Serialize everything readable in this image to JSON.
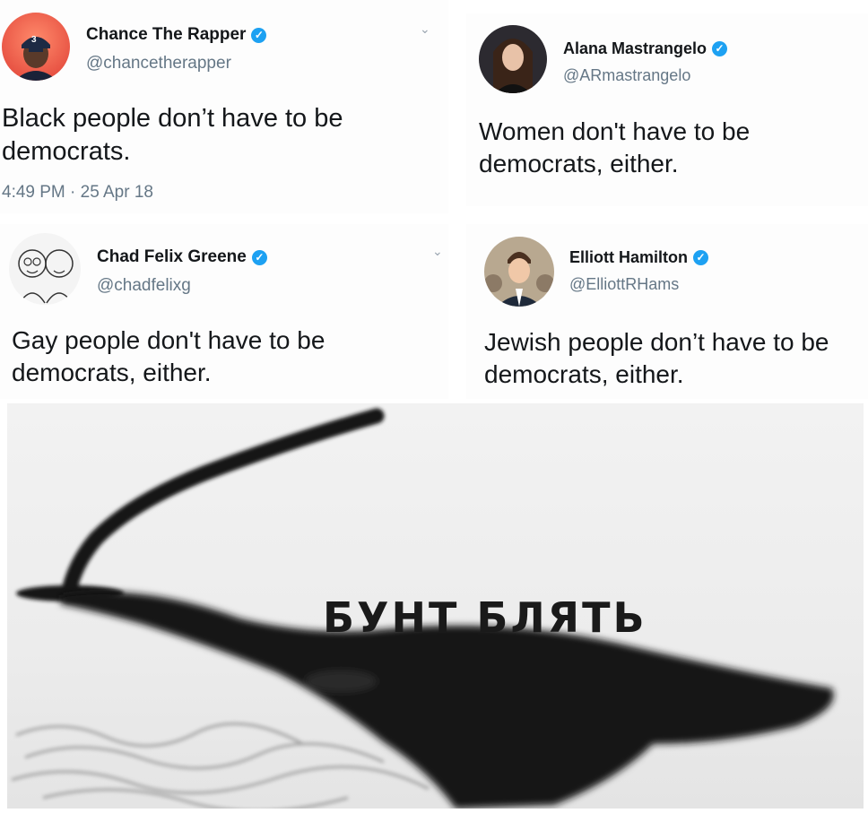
{
  "tweets": [
    {
      "name": "Chance The Rapper",
      "handle": "@chancetherapper",
      "text_lines": [
        "Black people don’t have to be",
        "democrats."
      ],
      "meta": "4:49 PM · 25 Apr 18",
      "avatar_badge": "3"
    },
    {
      "name": "Alana Mastrangelo",
      "handle": "@ARmastrangelo",
      "text_lines": [
        "Women don't have to be",
        "democrats, either."
      ]
    },
    {
      "name": "Chad Felix Greene",
      "handle": "@chadfelixg",
      "text_lines": [
        "Gay people don't have to be",
        "democrats, either."
      ]
    },
    {
      "name": "Elliott Hamilton",
      "handle": "@ElliottRHams",
      "text_lines": [
        "Jewish people don’t have to be",
        "democrats, either."
      ]
    }
  ],
  "verified_glyph": "✓",
  "chevron_glyph": "⌄",
  "meme": {
    "caption": "БУНТ БЛЯТЬ"
  },
  "colors": {
    "verified": "#1da1f2",
    "handle": "#657786",
    "text": "#14171a"
  }
}
